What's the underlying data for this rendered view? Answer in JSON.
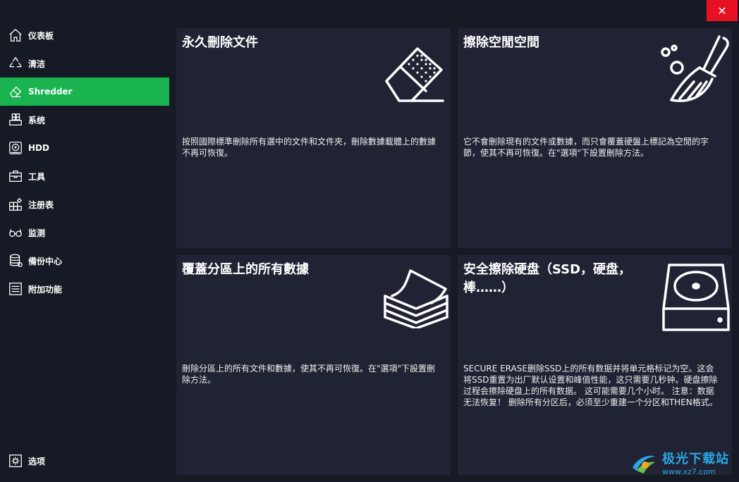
{
  "window": {
    "close_glyph": "✕"
  },
  "sidebar": {
    "items": [
      {
        "label": "仪表板",
        "icon": "home-icon"
      },
      {
        "label": "清洁",
        "icon": "recycle-icon"
      },
      {
        "label": "Shredder",
        "icon": "eraser-icon",
        "active": true
      },
      {
        "label": "系统",
        "icon": "windows-icon"
      },
      {
        "label": "HDD",
        "icon": "hdd-icon"
      },
      {
        "label": "工具",
        "icon": "toolbox-icon"
      },
      {
        "label": "注册表",
        "icon": "registry-icon"
      },
      {
        "label": "监测",
        "icon": "glasses-icon"
      },
      {
        "label": "備份中心",
        "icon": "database-icon"
      },
      {
        "label": "附加功能",
        "icon": "list-icon"
      }
    ],
    "bottom": {
      "label": "选项",
      "icon": "gear-icon"
    }
  },
  "cards": [
    {
      "title": "永久刪除文件",
      "desc": "按照國際標準刪除所有選中的文件和文件夾，刪除數據載體上的數據不再可恢復。",
      "icon": "eraser-icon"
    },
    {
      "title": "擦除空閒空間",
      "desc": "它不會刪除現有的文件或數據，而只會覆蓋硬盤上標記為空閒的字節，使其不再可恢復。在\"選項\"下設置刪除方法。",
      "icon": "broom-icon"
    },
    {
      "title": "覆蓋分區上的所有數據",
      "desc": "刪除分區上的所有文件和數據，使其不再可恢復。在\"選項\"下設置刪除方法。",
      "icon": "paper-stack-icon"
    },
    {
      "title": "安全擦除硬盘（SSD，硬盘，棒……）",
      "desc": "SECURE ERASE删除SSD上的所有数据并将单元格标记为空。这会将SSD重置为出厂默认设置和峰值性能，这只需要几秒钟。硬盘擦除过程会擦除硬盘上的所有数据。 这可能需要几个小时。 注意：数据无法恢复！ 删除所有分区后，必须至少重建一个分区和THEN格式。",
      "icon": "hard-drive-icon"
    }
  ],
  "watermark": {
    "title": "极光下载站",
    "url": "www.xz7.com"
  },
  "colors": {
    "accent": "#19b44f",
    "card_bg": "#1f2333",
    "window_bg": "#161a24",
    "close": "#e81123",
    "watermark": "#2aa7e6"
  }
}
